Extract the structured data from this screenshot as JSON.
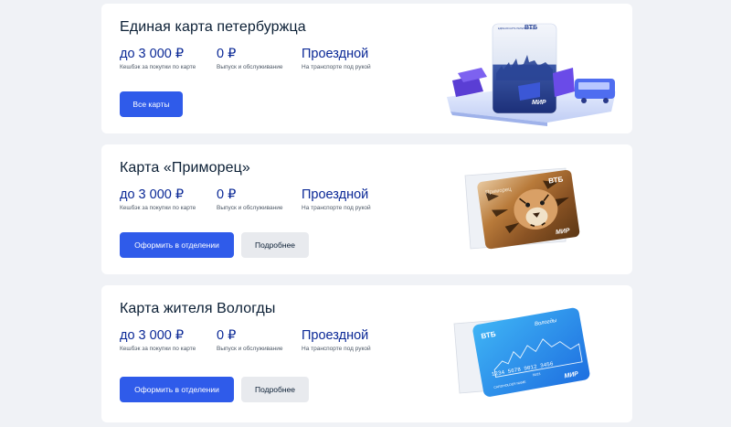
{
  "cards": [
    {
      "title": "Единая карта петербуржца",
      "features": [
        {
          "value": "до 3 000 ₽",
          "caption": "Кешбэк за покупки по карте"
        },
        {
          "value": "0 ₽",
          "caption": "Выпуск и обслуживание"
        },
        {
          "value": "Проездной",
          "caption": "На транспорте под рукой"
        }
      ],
      "primary_button": "Все карты",
      "card_image": {
        "bank": "ВТБ",
        "payment": "МИР",
        "top_text": "ЕДИНАЯ КАРТА ПЕТЕРБУРЖЦА"
      }
    },
    {
      "title": "Карта «Приморец»",
      "features": [
        {
          "value": "до 3 000 ₽",
          "caption": "Кешбэк за покупки по карте"
        },
        {
          "value": "0 ₽",
          "caption": "Выпуск и обслуживание"
        },
        {
          "value": "Проездной",
          "caption": "На транспорте под рукой"
        }
      ],
      "primary_button": "Оформить в отделении",
      "secondary_button": "Подробнее",
      "card_image": {
        "bank": "ВТБ",
        "payment": "МИР",
        "top_text": "Приморец"
      }
    },
    {
      "title": "Карта жителя Вологды",
      "features": [
        {
          "value": "до 3 000 ₽",
          "caption": "Кешбэк за покупки по карте"
        },
        {
          "value": "0 ₽",
          "caption": "Выпуск и обслуживание"
        },
        {
          "value": "Проездной",
          "caption": "На транспорте под рукой"
        }
      ],
      "primary_button": "Оформить в отделении",
      "secondary_button": "Подробнее",
      "card_image": {
        "bank": "ВТБ",
        "payment": "МИР",
        "top_text": "Вологды",
        "number": "1234 5678 9012 3456",
        "holder": "CARDHOLDER NAME",
        "expiry": "00/23"
      }
    }
  ],
  "colors": {
    "page_bg": "#f0f2f6",
    "title": "#0b1f35",
    "accent_value": "#0a2896",
    "primary_button": "#2f5bea",
    "secondary_button": "#e8eaee"
  }
}
